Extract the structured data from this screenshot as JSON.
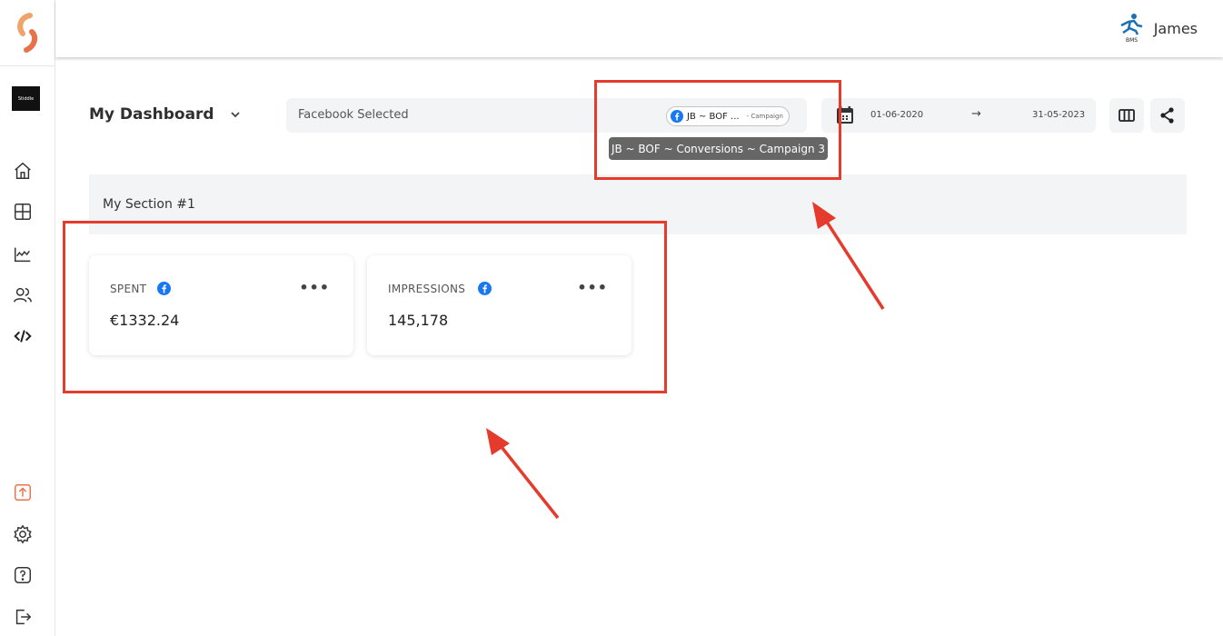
{
  "workspace": {
    "logo_text": "Stiddle"
  },
  "user": {
    "name": "James",
    "avatar_label": "BMS"
  },
  "dashboard": {
    "title": "My Dashboard"
  },
  "filter": {
    "label": "Facebook Selected",
    "chip_text": "JB ~ BOF ...",
    "chip_sub": "- Campaign",
    "tooltip": "JB ~ BOF ~ Conversions ~ Campaign 3"
  },
  "dates": {
    "start": "01-06-2020",
    "arrow": "→",
    "end": "31-05-2023"
  },
  "section": {
    "title": "My Section #1"
  },
  "cards": [
    {
      "label": "SPENT",
      "value": "€1332.24",
      "menu": "•••"
    },
    {
      "label": "IMPRESSIONS",
      "value": "145,178",
      "menu": "•••"
    }
  ],
  "colors": {
    "accent": "#e8734a",
    "facebook": "#1877f2",
    "annotation": "#e53b2c"
  },
  "icons": [
    "logo-icon",
    "home-icon",
    "dashboard-icon",
    "analytics-icon",
    "users-icon",
    "code-icon",
    "upload-icon",
    "settings-icon",
    "help-icon",
    "logout-icon",
    "facebook-icon",
    "calendar-icon",
    "columns-icon",
    "share-icon",
    "chevron-down-icon"
  ]
}
